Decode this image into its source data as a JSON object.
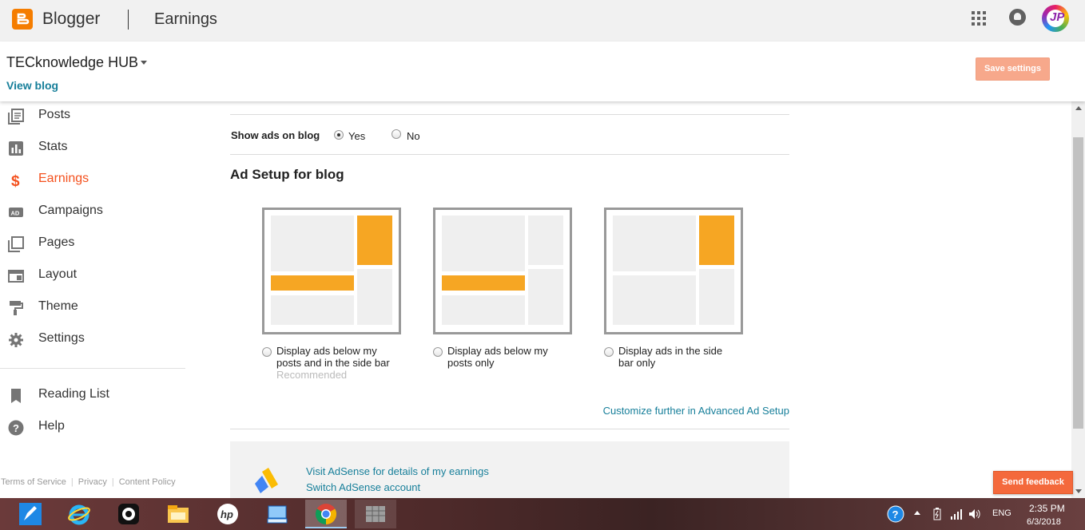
{
  "topbar": {
    "brand": "Blogger",
    "section": "Earnings"
  },
  "blog": {
    "name": "TECknowledge HUB",
    "view_blog": "View blog",
    "save_settings": "Save settings"
  },
  "sidebar": {
    "items": [
      {
        "label": "Posts",
        "icon": "posts-icon"
      },
      {
        "label": "Stats",
        "icon": "stats-icon"
      },
      {
        "label": "Earnings",
        "icon": "dollar-icon",
        "active": true
      },
      {
        "label": "Campaigns",
        "icon": "ad-icon"
      },
      {
        "label": "Pages",
        "icon": "pages-icon"
      },
      {
        "label": "Layout",
        "icon": "layout-icon"
      },
      {
        "label": "Theme",
        "icon": "paint-roller-icon"
      },
      {
        "label": "Settings",
        "icon": "gear-icon"
      }
    ],
    "secondary": [
      {
        "label": "Reading List",
        "icon": "bookmark-icon"
      },
      {
        "label": "Help",
        "icon": "help-icon"
      }
    ],
    "footer": {
      "terms": "Terms of Service",
      "privacy": "Privacy",
      "policy": "Content Policy"
    }
  },
  "main": {
    "show_ads_label": "Show ads on blog",
    "yes": "Yes",
    "no": "No",
    "show_ads_selected": "Yes",
    "ad_setup_title": "Ad Setup for blog",
    "layouts": [
      {
        "caption": "Display ads below my posts and in the side bar",
        "note": "Recommended"
      },
      {
        "caption": "Display ads below my posts only",
        "note": ""
      },
      {
        "caption": "Display ads in the side bar only",
        "note": ""
      }
    ],
    "customize_link": "Customize further in Advanced Ad Setup",
    "adsense": {
      "details_link": "Visit AdSense for details of my earnings",
      "switch_link": "Switch AdSense account"
    }
  },
  "feedback": "Send feedback",
  "taskbar": {
    "lang": "ENG",
    "time": "2:35 PM",
    "date": "6/3/2018"
  },
  "colors": {
    "accent": "#f57d00",
    "active_nav": "#f4511e",
    "link": "#177f9a",
    "ad_block": "#f6a623",
    "save_btn": "#f7a88b",
    "feedback_btn": "#f4693c"
  }
}
